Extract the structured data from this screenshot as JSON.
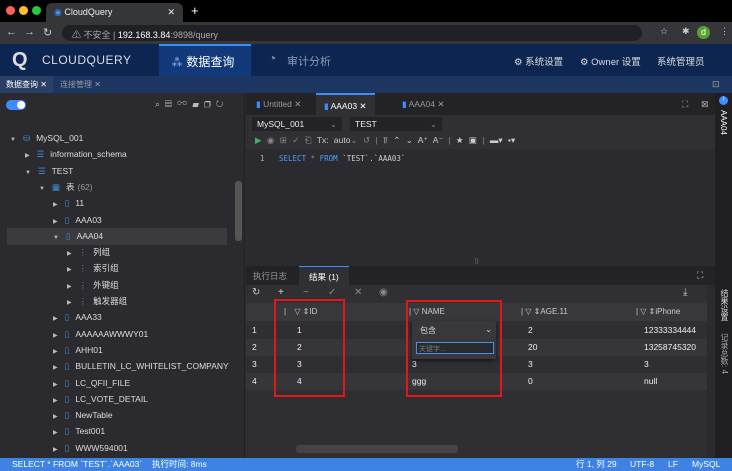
{
  "browser": {
    "tab_title": "CloudQuery",
    "insecure": "不安全",
    "url_host": "192.168.3.84",
    "url_rest": ":9898/query",
    "avatar": "d"
  },
  "header": {
    "logo": "CLOUDQUERY",
    "nav": [
      {
        "label": "数据查询"
      },
      {
        "label": "审计分析"
      }
    ],
    "right": [
      "系统设置",
      "Owner 设置",
      "系统管理员"
    ]
  },
  "page_tabs": [
    {
      "label": "数据查询"
    },
    {
      "label": "连接管理"
    }
  ],
  "tree": [
    {
      "label": "MySQL_001",
      "level": 0,
      "expanded": true
    },
    {
      "label": "information_schema",
      "level": 1
    },
    {
      "label": "TEST",
      "level": 1,
      "expanded": true
    },
    {
      "label": "表",
      "count": "(62)",
      "level": 2,
      "expanded": true
    },
    {
      "label": "11",
      "level": 3
    },
    {
      "label": "AAA03",
      "level": 3
    },
    {
      "label": "AAA04",
      "level": 3,
      "expanded": true,
      "selected": true
    },
    {
      "label": "列组",
      "level": 4
    },
    {
      "label": "索引组",
      "level": 4
    },
    {
      "label": "外键组",
      "level": 4
    },
    {
      "label": "触发器组",
      "level": 4
    },
    {
      "label": "AAA33",
      "level": 3
    },
    {
      "label": "AAAAAAWWWY01",
      "level": 3
    },
    {
      "label": "AHH01",
      "level": 3
    },
    {
      "label": "BULLETIN_LC_WHITELIST_COMPANY",
      "level": 3
    },
    {
      "label": "LC_QFII_FILE",
      "level": 3
    },
    {
      "label": "LC_VOTE_DETAIL",
      "level": 3
    },
    {
      "label": "NewTable",
      "level": 3
    },
    {
      "label": "Test001",
      "level": 3
    },
    {
      "label": "WWW594001",
      "level": 3
    }
  ],
  "editor_tabs": [
    "Untitled",
    "AAA03",
    "AAA04"
  ],
  "connection": "MySQL_001",
  "database": "TEST",
  "tx": "Tx: auto",
  "sql": {
    "line": "1",
    "kw1": "SELECT",
    "star": "*",
    "kw2": "FROM",
    "rest": "`TEST`.`AAA03`"
  },
  "result_tabs": [
    "执行日志",
    "结果 (1)"
  ],
  "columns": [
    "ID",
    "NAME",
    "AGE.11",
    "iPhone"
  ],
  "rows": [
    [
      "1",
      "1",
      "",
      "2",
      "12333334444"
    ],
    [
      "2",
      "2",
      "",
      "20",
      "13258745320"
    ],
    [
      "3",
      "3",
      "3",
      "3",
      "3"
    ],
    [
      "4",
      "4",
      "ggg",
      "0",
      "null"
    ]
  ],
  "filter": {
    "op": "包含",
    "placeholder": "关键字..."
  },
  "right_panel": {
    "title": "AAA04",
    "settings": "结果设置",
    "total": "记录总数: 4"
  },
  "status": {
    "sql": "SELECT * FROM `TEST`.`AAA03`",
    "time": "执行时间: 8ms",
    "pos": "行 1, 列 29",
    "enc": "UTF-8",
    "eol": "LF",
    "lang": "MySQL"
  }
}
